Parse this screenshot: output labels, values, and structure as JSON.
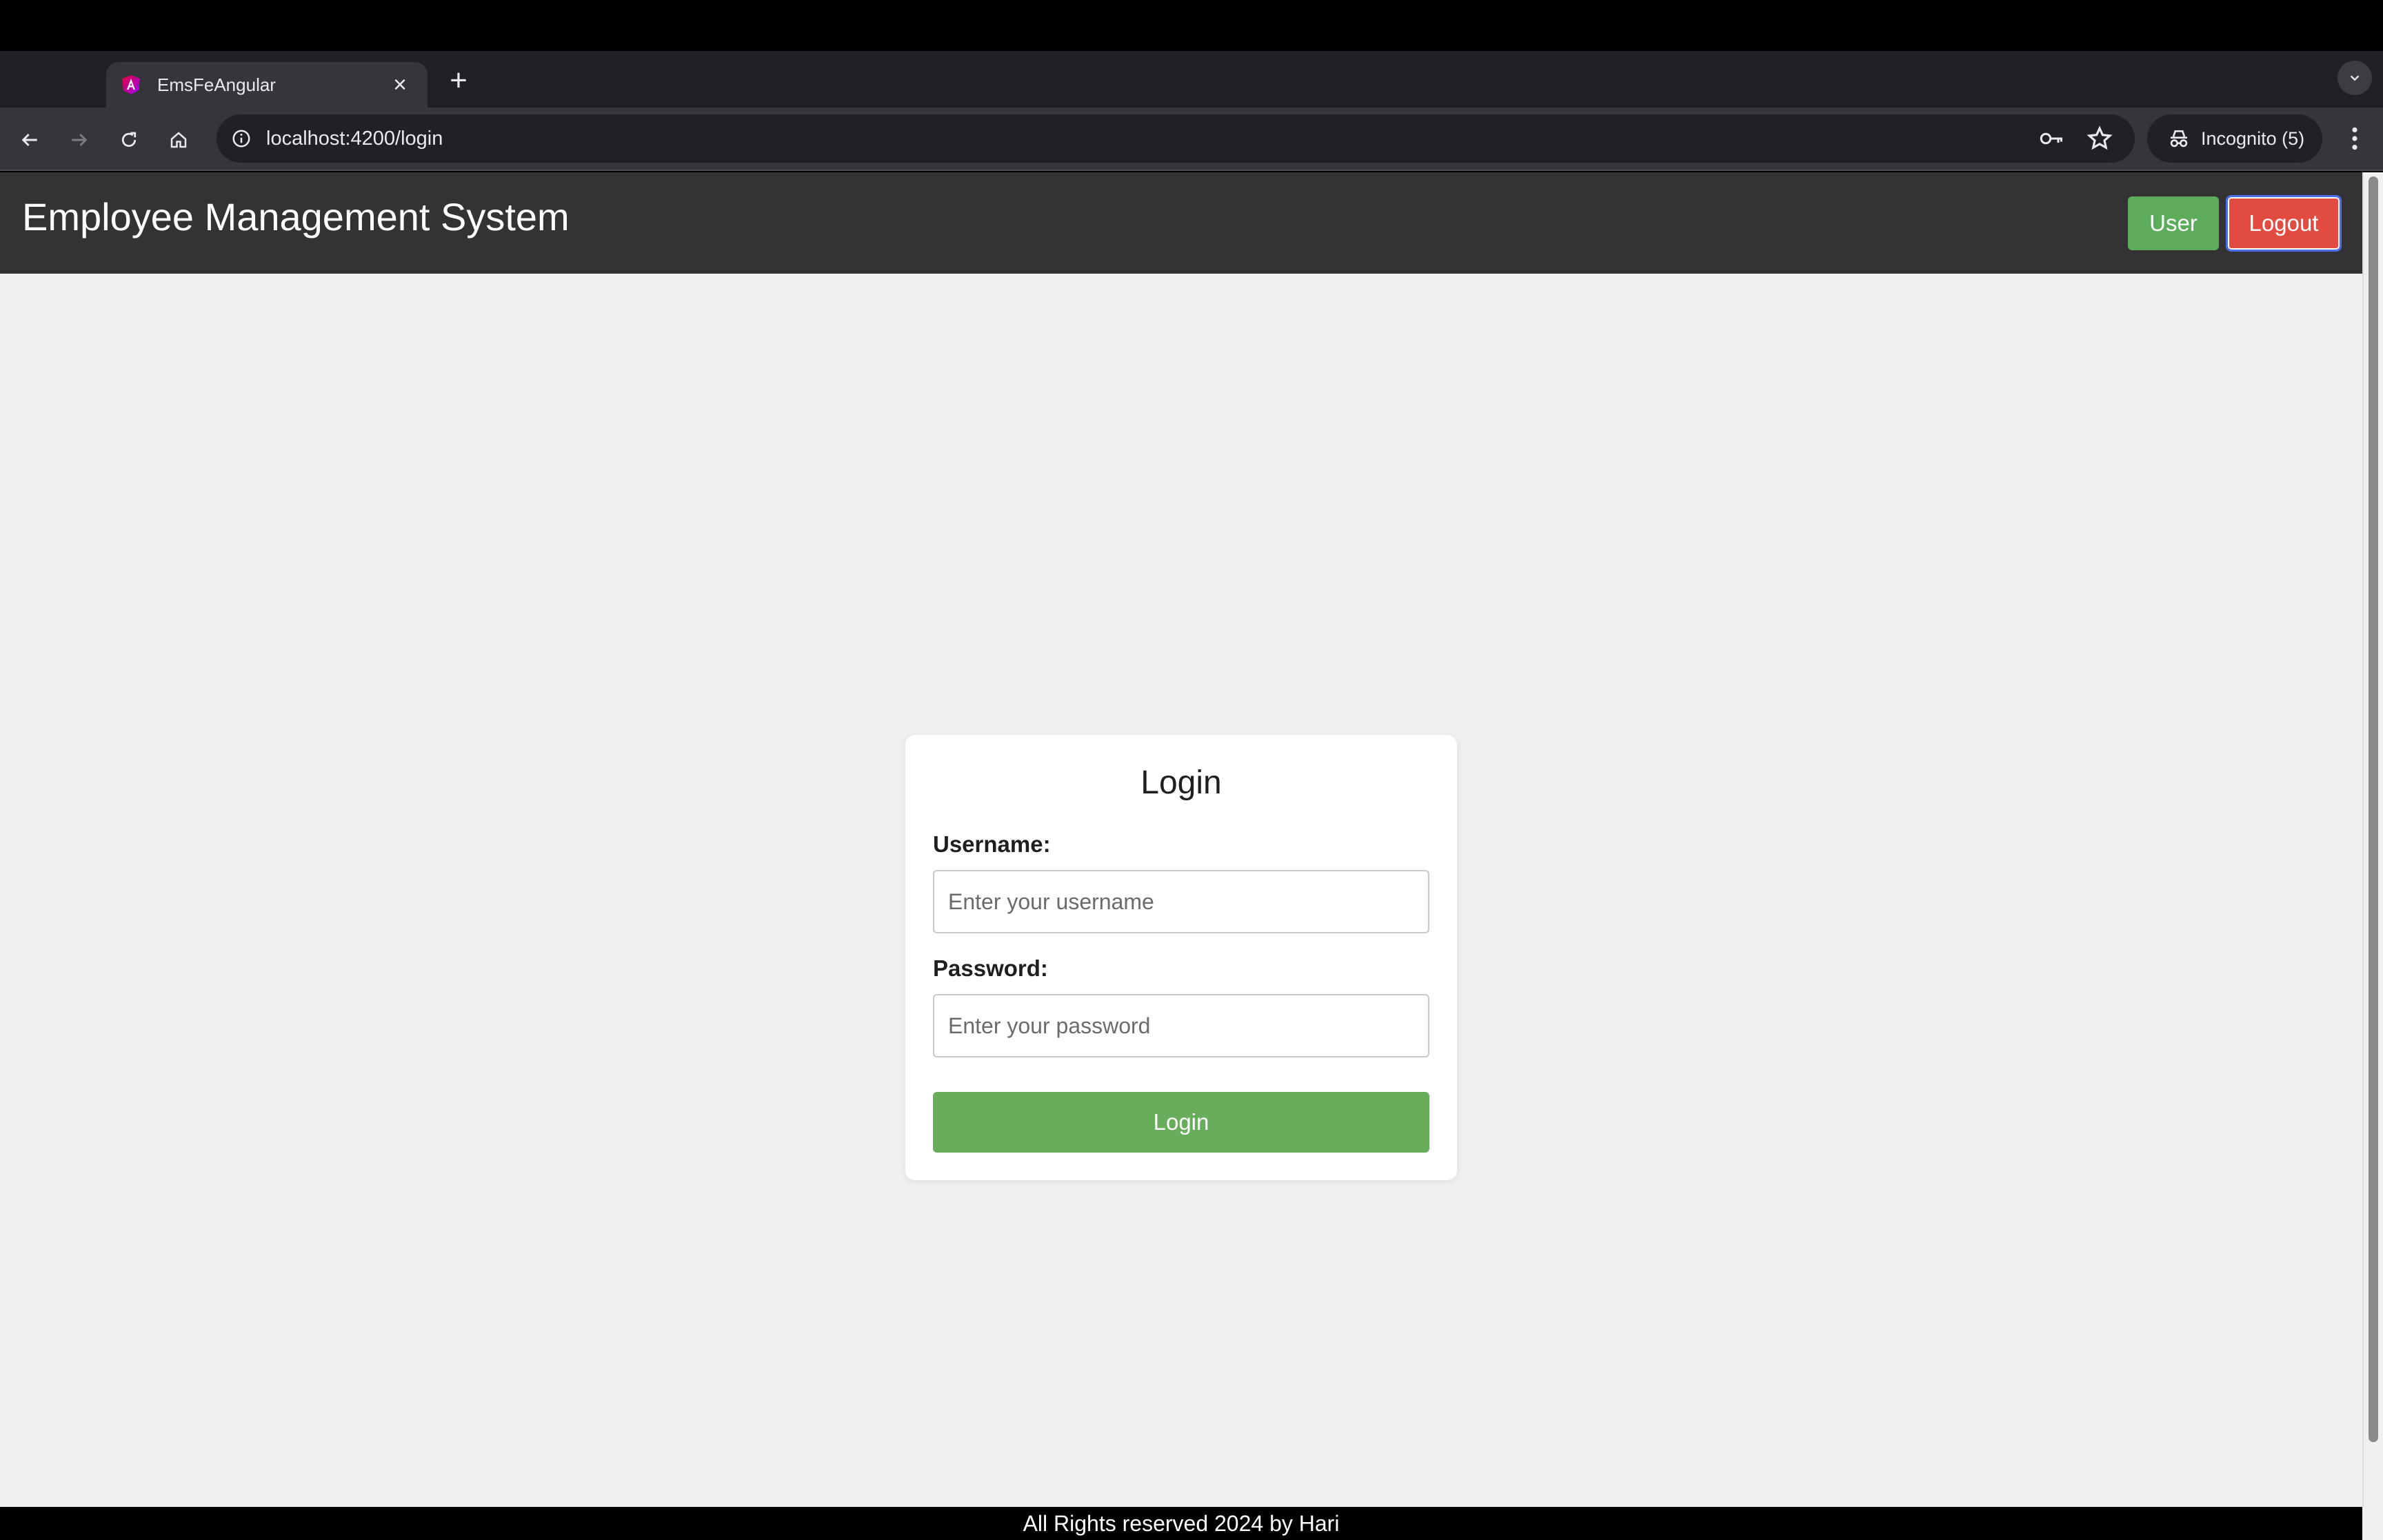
{
  "browser": {
    "tab_title": "EmsFeAngular",
    "url": "localhost:4200/login",
    "incognito_label": "Incognito (5)"
  },
  "header": {
    "title": "Employee Management System",
    "user_button": "User",
    "logout_button": "Logout"
  },
  "login": {
    "title": "Login",
    "username_label": "Username:",
    "username_placeholder": "Enter your username",
    "password_label": "Password:",
    "password_placeholder": "Enter your password",
    "submit_label": "Login"
  },
  "footer": {
    "text": "All Rights reserved 2024 by Hari"
  },
  "colors": {
    "header_bg": "#333333",
    "user_button": "#5cac5c",
    "logout_button": "#e24b40",
    "login_button": "#68ad5c",
    "page_bg": "#f0f0f0"
  }
}
